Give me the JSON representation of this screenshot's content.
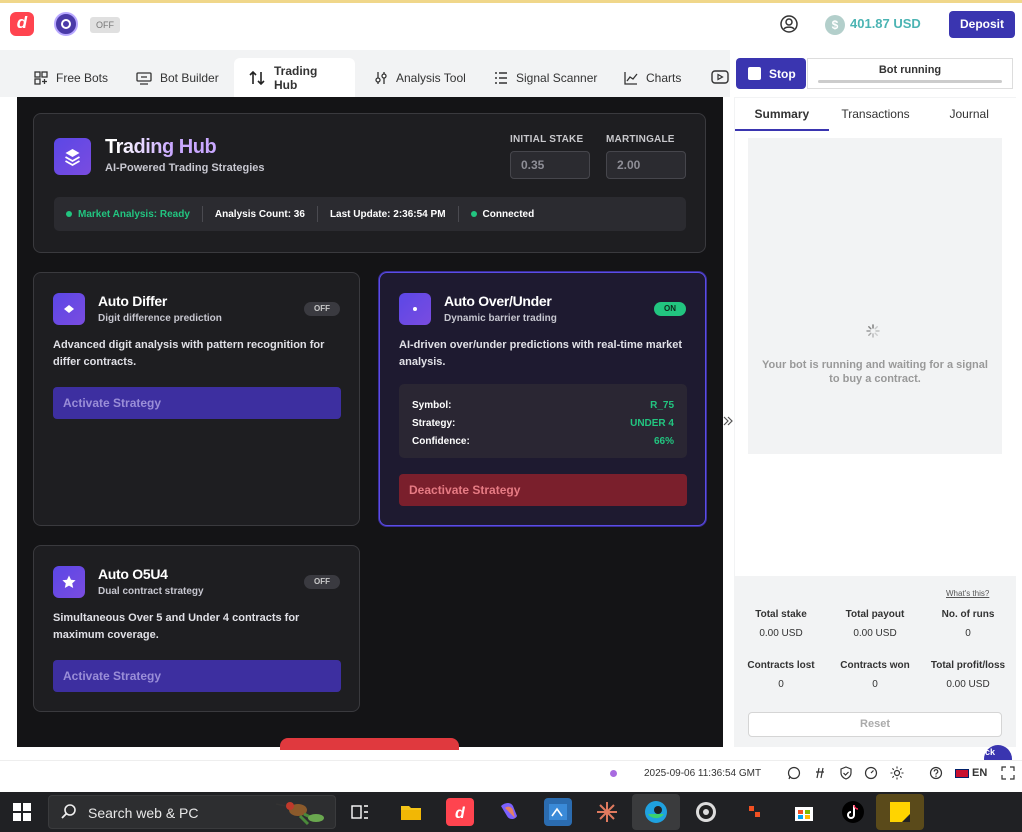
{
  "header": {
    "toggle_label": "OFF",
    "balance": "401.87 USD",
    "deposit_label": "Deposit"
  },
  "tabs": [
    {
      "label": "Free Bots",
      "icon": "grid-icon"
    },
    {
      "label": "Bot Builder",
      "icon": "builder-icon"
    },
    {
      "label": "Trading Hub",
      "icon": "arrows-updown-icon",
      "active": true
    },
    {
      "label": "Analysis Tool",
      "icon": "sliders-icon"
    },
    {
      "label": "Signal Scanner",
      "icon": "list-icon"
    },
    {
      "label": "Charts",
      "icon": "chart-icon"
    }
  ],
  "bot_controls": {
    "stop_label": "Stop",
    "status_label": "Bot running"
  },
  "hub": {
    "title": "Trading Hub",
    "subtitle": "AI-Powered Trading Strategies",
    "initial_stake_label": "INITIAL STAKE",
    "initial_stake_value": "0.35",
    "martingale_label": "MARTINGALE",
    "martingale_value": "2.00",
    "status": {
      "market": "Market Analysis: Ready",
      "count": "Analysis Count: 36",
      "update": "Last Update: 2:36:54 PM",
      "connection": "Connected"
    }
  },
  "strategies": {
    "differ": {
      "title": "Auto Differ",
      "subtitle": "Digit difference prediction",
      "state": "OFF",
      "description": "Advanced digit analysis with pattern recognition for differ contracts.",
      "button": "Activate Strategy"
    },
    "overunder": {
      "title": "Auto Over/Under",
      "subtitle": "Dynamic barrier trading",
      "state": "ON",
      "description": "AI-driven over/under predictions with real-time market analysis.",
      "details": [
        {
          "label": "Symbol:",
          "value": "R_75"
        },
        {
          "label": "Strategy:",
          "value": "UNDER 4"
        },
        {
          "label": "Confidence:",
          "value": "66%"
        }
      ],
      "button": "Deactivate Strategy"
    },
    "o5u4": {
      "title": "Auto O5U4",
      "subtitle": "Dual contract strategy",
      "state": "OFF",
      "description": "Simultaneous Over 5 and Under 4 contracts for maximum coverage.",
      "button": "Activate Strategy"
    }
  },
  "run_panel": {
    "tabs": [
      "Summary",
      "Transactions",
      "Journal"
    ],
    "waiting_text": "Your bot is running and waiting for a signal to buy a contract.",
    "whats_this": "What's this?",
    "stats": [
      {
        "label": "Total stake",
        "value": "0.00 USD"
      },
      {
        "label": "Total payout",
        "value": "0.00 USD"
      },
      {
        "label": "No. of runs",
        "value": "0"
      },
      {
        "label": "Contracts lost",
        "value": "0"
      },
      {
        "label": "Contracts won",
        "value": "0"
      },
      {
        "label": "Total profit/loss",
        "value": "0.00 USD"
      }
    ],
    "reset_label": "Reset",
    "chat_text": "Quick\nclaim"
  },
  "footer": {
    "timestamp": "2025-09-06 11:36:54 GMT",
    "language": "EN"
  },
  "taskbar": {
    "search_placeholder": "Search web & PC"
  },
  "colors": {
    "accent": "#3a35b0",
    "success": "#22c580",
    "danger": "#7a1f2c",
    "dark_bg": "#141416"
  }
}
